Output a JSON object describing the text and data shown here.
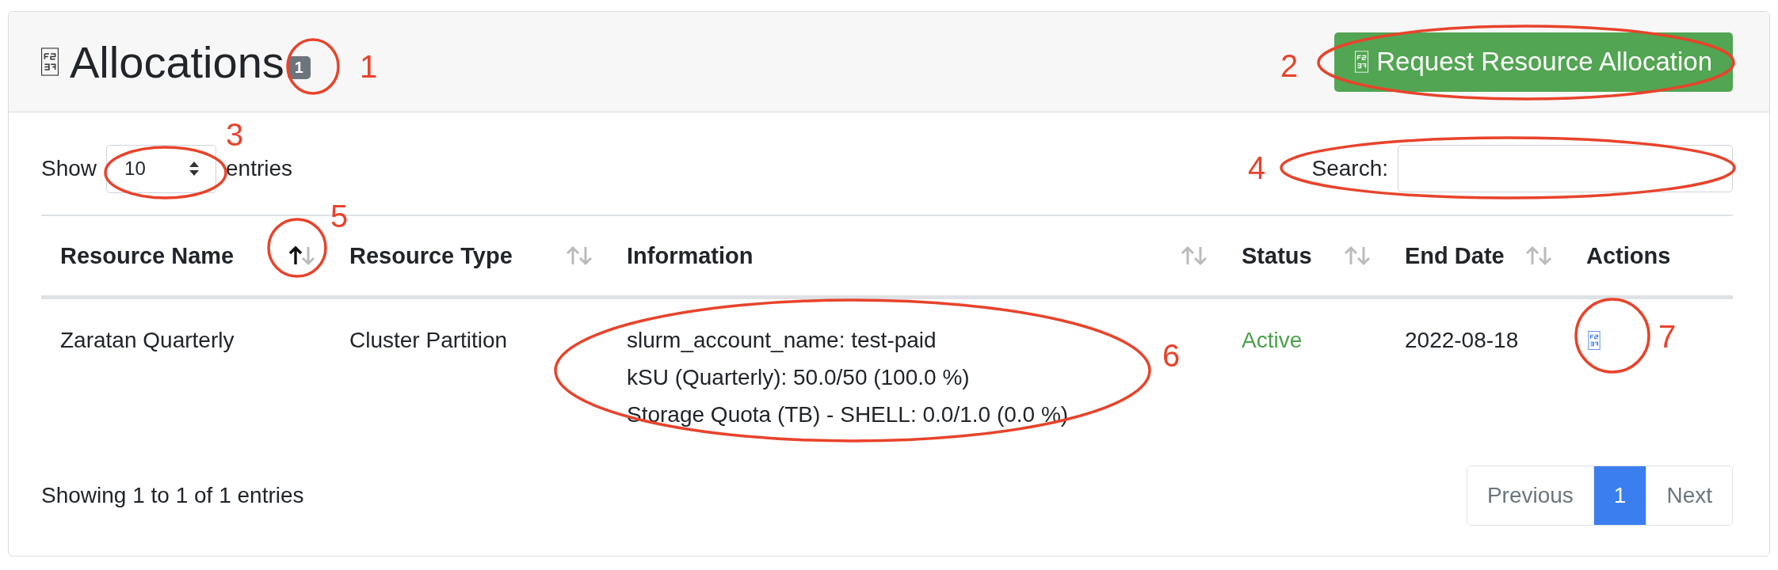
{
  "card": {
    "title": "Allocations",
    "count": "1",
    "request_button": "Request Resource Allocation"
  },
  "controls": {
    "show_label": "Show",
    "page_size": "10",
    "entries_label": "entries",
    "search_label": "Search:"
  },
  "table": {
    "columns": [
      {
        "label": "Resource Name",
        "sortable": true,
        "sorted_ascending": true
      },
      {
        "label": "Resource Type",
        "sortable": true,
        "sorted_ascending": false
      },
      {
        "label": "Information",
        "sortable": true,
        "sorted_ascending": false
      },
      {
        "label": "Status",
        "sortable": true,
        "sorted_ascending": false
      },
      {
        "label": "End Date",
        "sortable": true,
        "sorted_ascending": false
      },
      {
        "label": "Actions",
        "sortable": false
      }
    ],
    "rows": [
      {
        "resource_name": "Zaratan Quarterly",
        "resource_type": "Cluster Partition",
        "information": [
          "slurm_account_name: test-paid",
          "kSU (Quarterly): 50.0/50 (100.0 %)",
          "Storage Quota (TB) - SHELL: 0.0/1.0 (0.0 %)"
        ],
        "status": {
          "text": "Active",
          "kind": "active"
        },
        "end_date": "2022-08-18"
      }
    ]
  },
  "footer": {
    "info": "Showing 1 to 1 of 1 entries",
    "pagination": [
      {
        "label": "Previous",
        "selected": false
      },
      {
        "label": "1",
        "selected": true
      },
      {
        "label": "Next",
        "selected": false
      }
    ]
  },
  "annotations": [
    "1",
    "2",
    "3",
    "4",
    "5",
    "6",
    "7"
  ]
}
